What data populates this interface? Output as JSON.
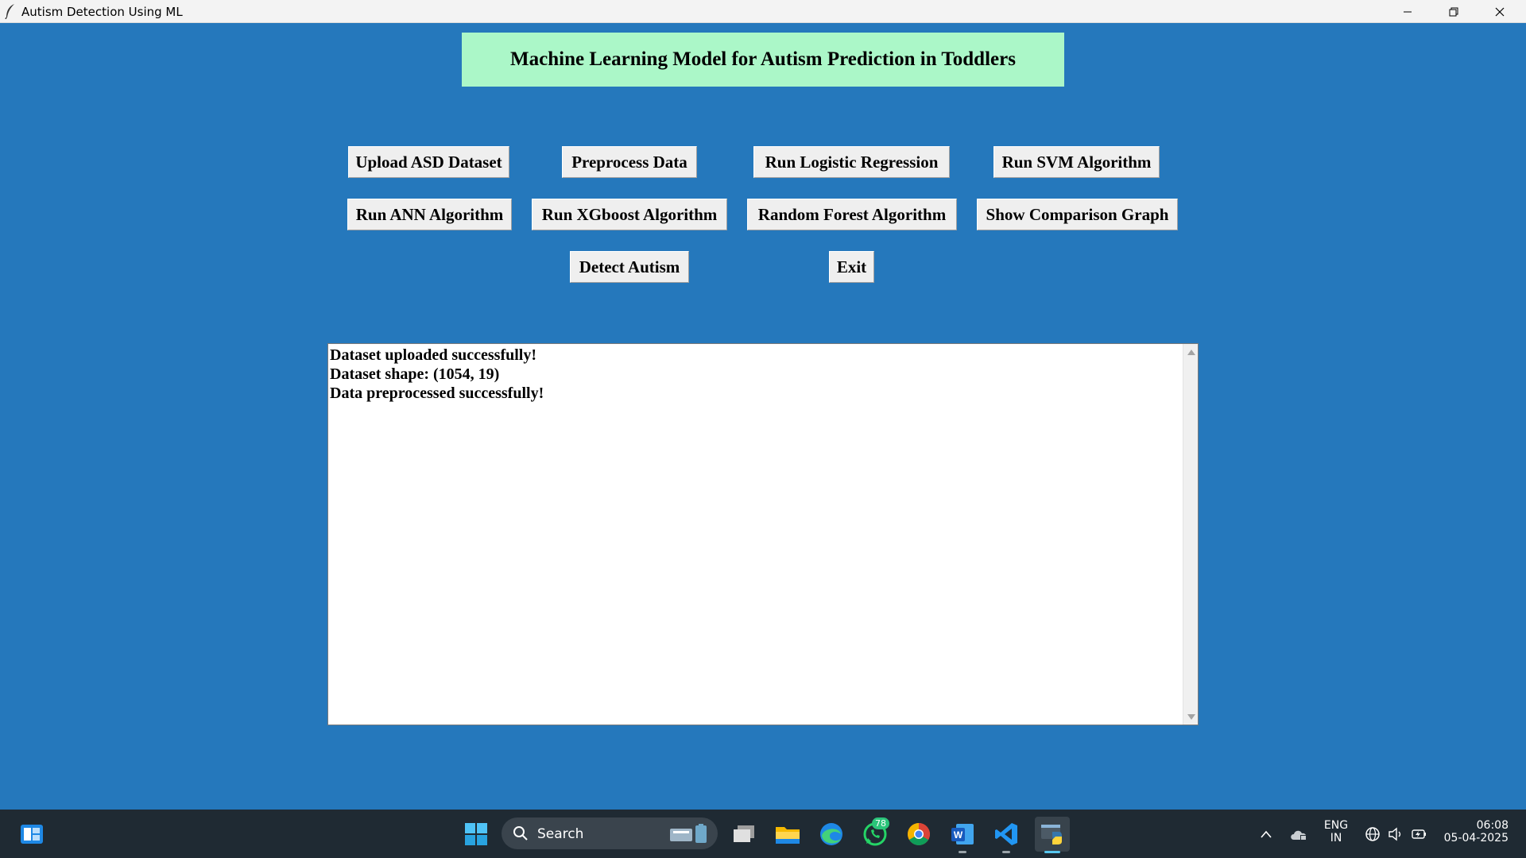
{
  "window": {
    "title": "Autism Detection Using ML",
    "heading": "Machine Learning Model for Autism Prediction in Toddlers",
    "buttons": {
      "upload": "Upload ASD Dataset",
      "preprocess": "Preprocess Data",
      "logistic": "Run Logistic Regression",
      "svm": "Run SVM Algorithm",
      "ann": "Run ANN Algorithm",
      "xgboost": "Run XGboost Algorithm",
      "random_forest": "Random Forest Algorithm",
      "comparison": "Show Comparison Graph",
      "detect": "Detect Autism",
      "exit": "Exit"
    },
    "output_lines": [
      "Dataset uploaded successfully!",
      "Dataset shape: (1054, 19)",
      "Data preprocessed successfully!"
    ]
  },
  "taskbar": {
    "search_label": "Search",
    "whatsapp_badge": "78",
    "language": "ENG",
    "region": "IN",
    "time": "06:08",
    "date": "05-04-2025"
  },
  "colors": {
    "window_bg": "#2578bc",
    "heading_bg": "#abf7c8",
    "button_bg": "#efefef",
    "taskbar_bg": "#1f2a33"
  }
}
